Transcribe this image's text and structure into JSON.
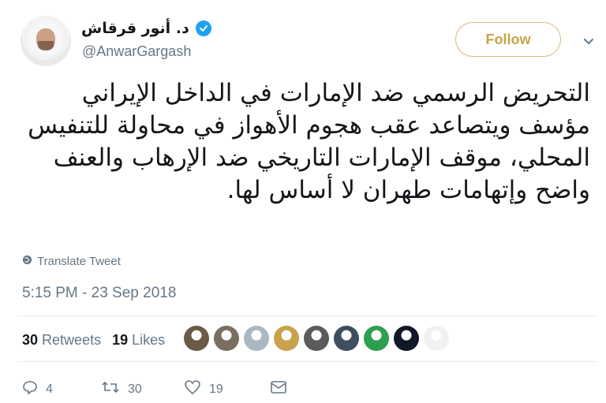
{
  "user": {
    "display_name": "د. أنور قرقاش",
    "handle": "@AnwarGargash",
    "verified": true
  },
  "follow_button": {
    "label": "Follow",
    "color": "#c8a24b"
  },
  "tweet": {
    "text": "التحريض الرسمي ضد الإمارات في الداخل الإيراني مؤسف ويتصاعد  عقب هجوم الأهواز في محاولة للتنفيس المحلي، موقف الإمارات التاريخي ضد الإرهاب والعنف واضح  وإتهامات طهران لا أساس لها.",
    "translate_label": "Translate Tweet",
    "timestamp": "5:15 PM - 23 Sep 2018"
  },
  "stats": {
    "retweets_count": "30",
    "retweets_label": "Retweets",
    "likes_count": "19",
    "likes_label": "Likes"
  },
  "likers": [
    {
      "name": "liker-1",
      "color": "#6b5a44"
    },
    {
      "name": "liker-2",
      "color": "#7a6e5e"
    },
    {
      "name": "liker-3",
      "color": "#aab8c2"
    },
    {
      "name": "liker-4",
      "color": "#c9a24b"
    },
    {
      "name": "liker-5",
      "color": "#5b5b5b"
    },
    {
      "name": "liker-6",
      "color": "#3d4f5e"
    },
    {
      "name": "liker-7",
      "color": "#2e9e4f"
    },
    {
      "name": "liker-8",
      "color": "#111827"
    },
    {
      "name": "liker-9",
      "color": "#f1f1f1"
    }
  ],
  "actions": {
    "reply_count": "4",
    "retweet_count": "30",
    "like_count": "19"
  },
  "icons": {
    "verified": "verified-badge-icon",
    "chevron": "chevron-down-icon",
    "globe": "globe-icon",
    "reply": "reply-icon",
    "retweet": "retweet-icon",
    "like": "heart-icon",
    "dm": "envelope-icon"
  },
  "colors": {
    "twitter_blue": "#1da1f2",
    "text_secondary": "#657786",
    "divider": "#e6ecf0"
  }
}
